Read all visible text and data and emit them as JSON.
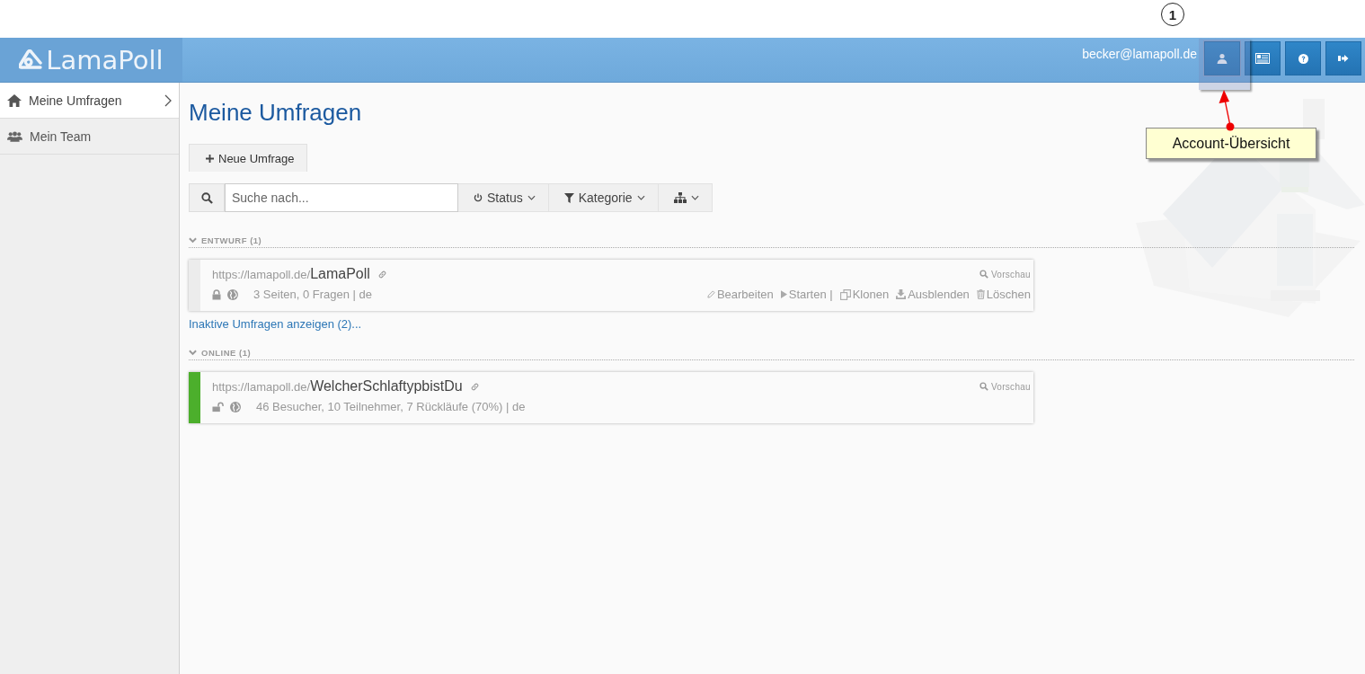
{
  "annotation": {
    "step": "1",
    "callout": "Account-Übersicht"
  },
  "header": {
    "logo": "LamaPoll",
    "user": "becker@lamapoll.de",
    "buttons": [
      {
        "kind": "account",
        "highlighted": true
      },
      {
        "kind": "news",
        "highlighted": false
      },
      {
        "kind": "help",
        "highlighted": false
      },
      {
        "kind": "logout",
        "highlighted": false
      }
    ]
  },
  "sidebar": {
    "items": [
      {
        "kind": "home",
        "label": "Meine Umfragen",
        "selected": true
      },
      {
        "kind": "team",
        "label": "Mein Team",
        "selected": false
      }
    ]
  },
  "main": {
    "title": "Meine Umfragen",
    "new_button": "Neue Umfrage",
    "search": {
      "placeholder": "Suche nach..."
    },
    "filters": [
      {
        "kind": "status",
        "label": "Status"
      },
      {
        "kind": "category",
        "label": "Kategorie"
      },
      {
        "kind": "structure"
      }
    ],
    "sections": [
      {
        "heading": "ENTWURF (1)",
        "expanded": true,
        "surveys": [
          {
            "base": "https://lamapoll.de/",
            "slug": "LamaPoll",
            "online": false,
            "locked": true,
            "stats": "3 Seiten, 0 Fragen | de",
            "preview": "Vorschau",
            "actions": [
              {
                "kind": "edit",
                "label": "Bearbeiten"
              },
              {
                "kind": "start",
                "label": "Starten |"
              },
              {
                "kind": "clone",
                "label": "Klonen"
              },
              {
                "kind": "hide",
                "label": "Ausblenden"
              },
              {
                "kind": "delete",
                "label": "Löschen"
              }
            ]
          }
        ],
        "link": "Inaktive Umfragen anzeigen (2)..."
      },
      {
        "heading": "ONLINE (1)",
        "expanded": true,
        "surveys": [
          {
            "base": "https://lamapoll.de/",
            "slug": "WelcherSchlaftypbistDu",
            "online": true,
            "locked": false,
            "stats": "46 Besucher, 10 Teilnehmer, 7 Rückläufe (70%) | de",
            "preview": "Vorschau"
          }
        ]
      }
    ]
  }
}
